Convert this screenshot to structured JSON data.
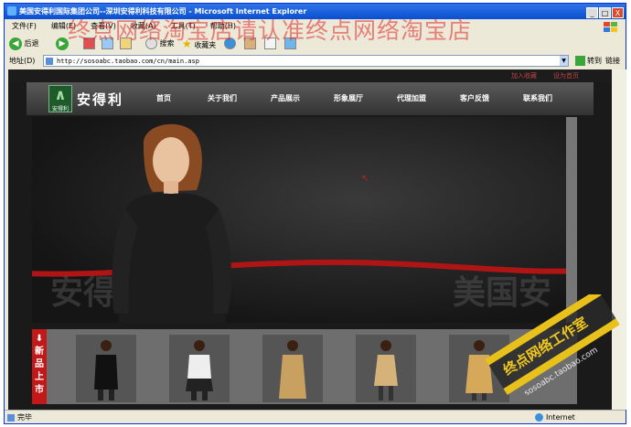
{
  "window": {
    "title": "美国安得利国际集团公司--深圳安得利科技有限公司 - Microsoft Internet Explorer",
    "controls": [
      "_",
      "□",
      "X"
    ]
  },
  "menu": [
    "文件(F)",
    "编辑(E)",
    "查看(V)",
    "收藏(A)",
    "工具(T)",
    "帮助(H)"
  ],
  "toolbar": {
    "back": "后退",
    "search": "搜索",
    "favorites": "收藏夹"
  },
  "address": {
    "label": "地址(D)",
    "url": "http://sosoabc.taobao.com/cn/main.asp",
    "go": "转到",
    "links": "链接"
  },
  "overlay_watermark": "终点网络淘宝店请认准终点网络淘宝店",
  "site": {
    "top_links": [
      "加入收藏",
      "设为首页"
    ],
    "logo_small": "安得利",
    "brand": "安得利",
    "nav": [
      "首页",
      "关于我们",
      "产品展示",
      "形象展厅",
      "代理加盟",
      "客户反馈",
      "联系我们"
    ],
    "banner_watermark": [
      "安得利集团",
      "美国安"
    ],
    "new_label": [
      "新",
      "品",
      "上",
      "市"
    ]
  },
  "studio_badge": {
    "name": "终点网络工作室",
    "url": "sosoabc.taobao.com"
  },
  "status": {
    "text": "完毕",
    "zone": "Internet"
  },
  "colors": {
    "accent": "#c21818",
    "title_bar": "#0a4fcf"
  }
}
